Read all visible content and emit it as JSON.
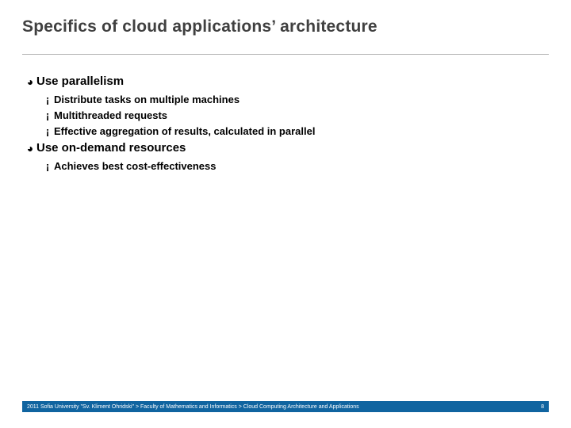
{
  "title": "Specifics of cloud applications’ architecture",
  "bullets": {
    "l1": [
      "Use parallelism",
      "Use on-demand resources"
    ],
    "l2a": [
      "Distribute tasks on multiple machines",
      "Multithreaded requests",
      "Effective aggregation of results, calculated in parallel"
    ],
    "l2b": [
      "Achieves best cost-effectiveness"
    ]
  },
  "glyphs": {
    "l1": "◕",
    "l2": "¡"
  },
  "footer": {
    "text": "2011 Sofia University \"Sv. Kliment Ohridski\" > Faculty of Mathematics and Informatics > Cloud Computing Architecture and Applications",
    "page": "8"
  }
}
